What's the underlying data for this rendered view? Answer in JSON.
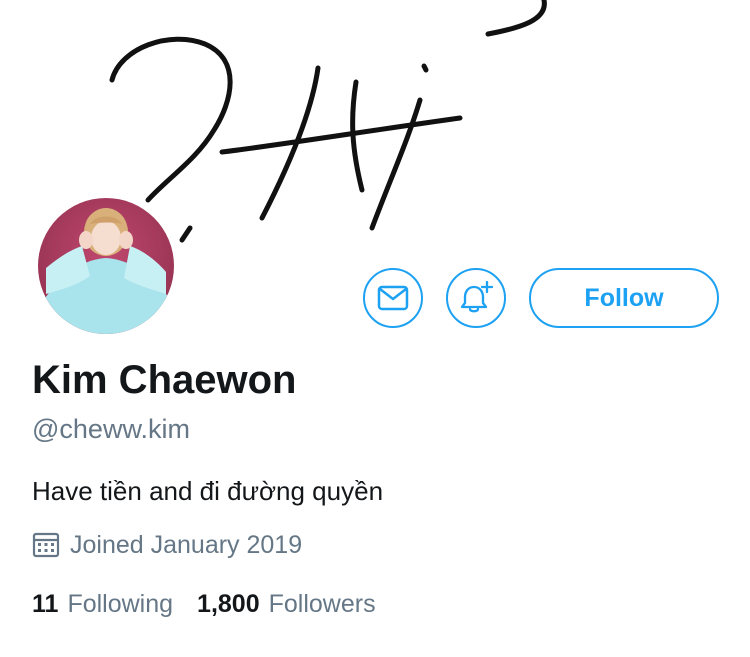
{
  "profile": {
    "name": "Kim Chaewon",
    "handle": "@cheww.kim",
    "bio": "Have tiền and đi đường quyền",
    "joined": "Joined January 2019"
  },
  "actions": {
    "message_icon": "envelope-icon",
    "notify_icon": "bell-plus-icon",
    "follow_label": "Follow"
  },
  "stats": {
    "following_count": "11",
    "following_label": "Following",
    "followers_count": "1,800",
    "followers_label": "Followers"
  },
  "colors": {
    "accent": "#1da1f2",
    "text_primary": "#14171a",
    "text_secondary": "#657786"
  }
}
